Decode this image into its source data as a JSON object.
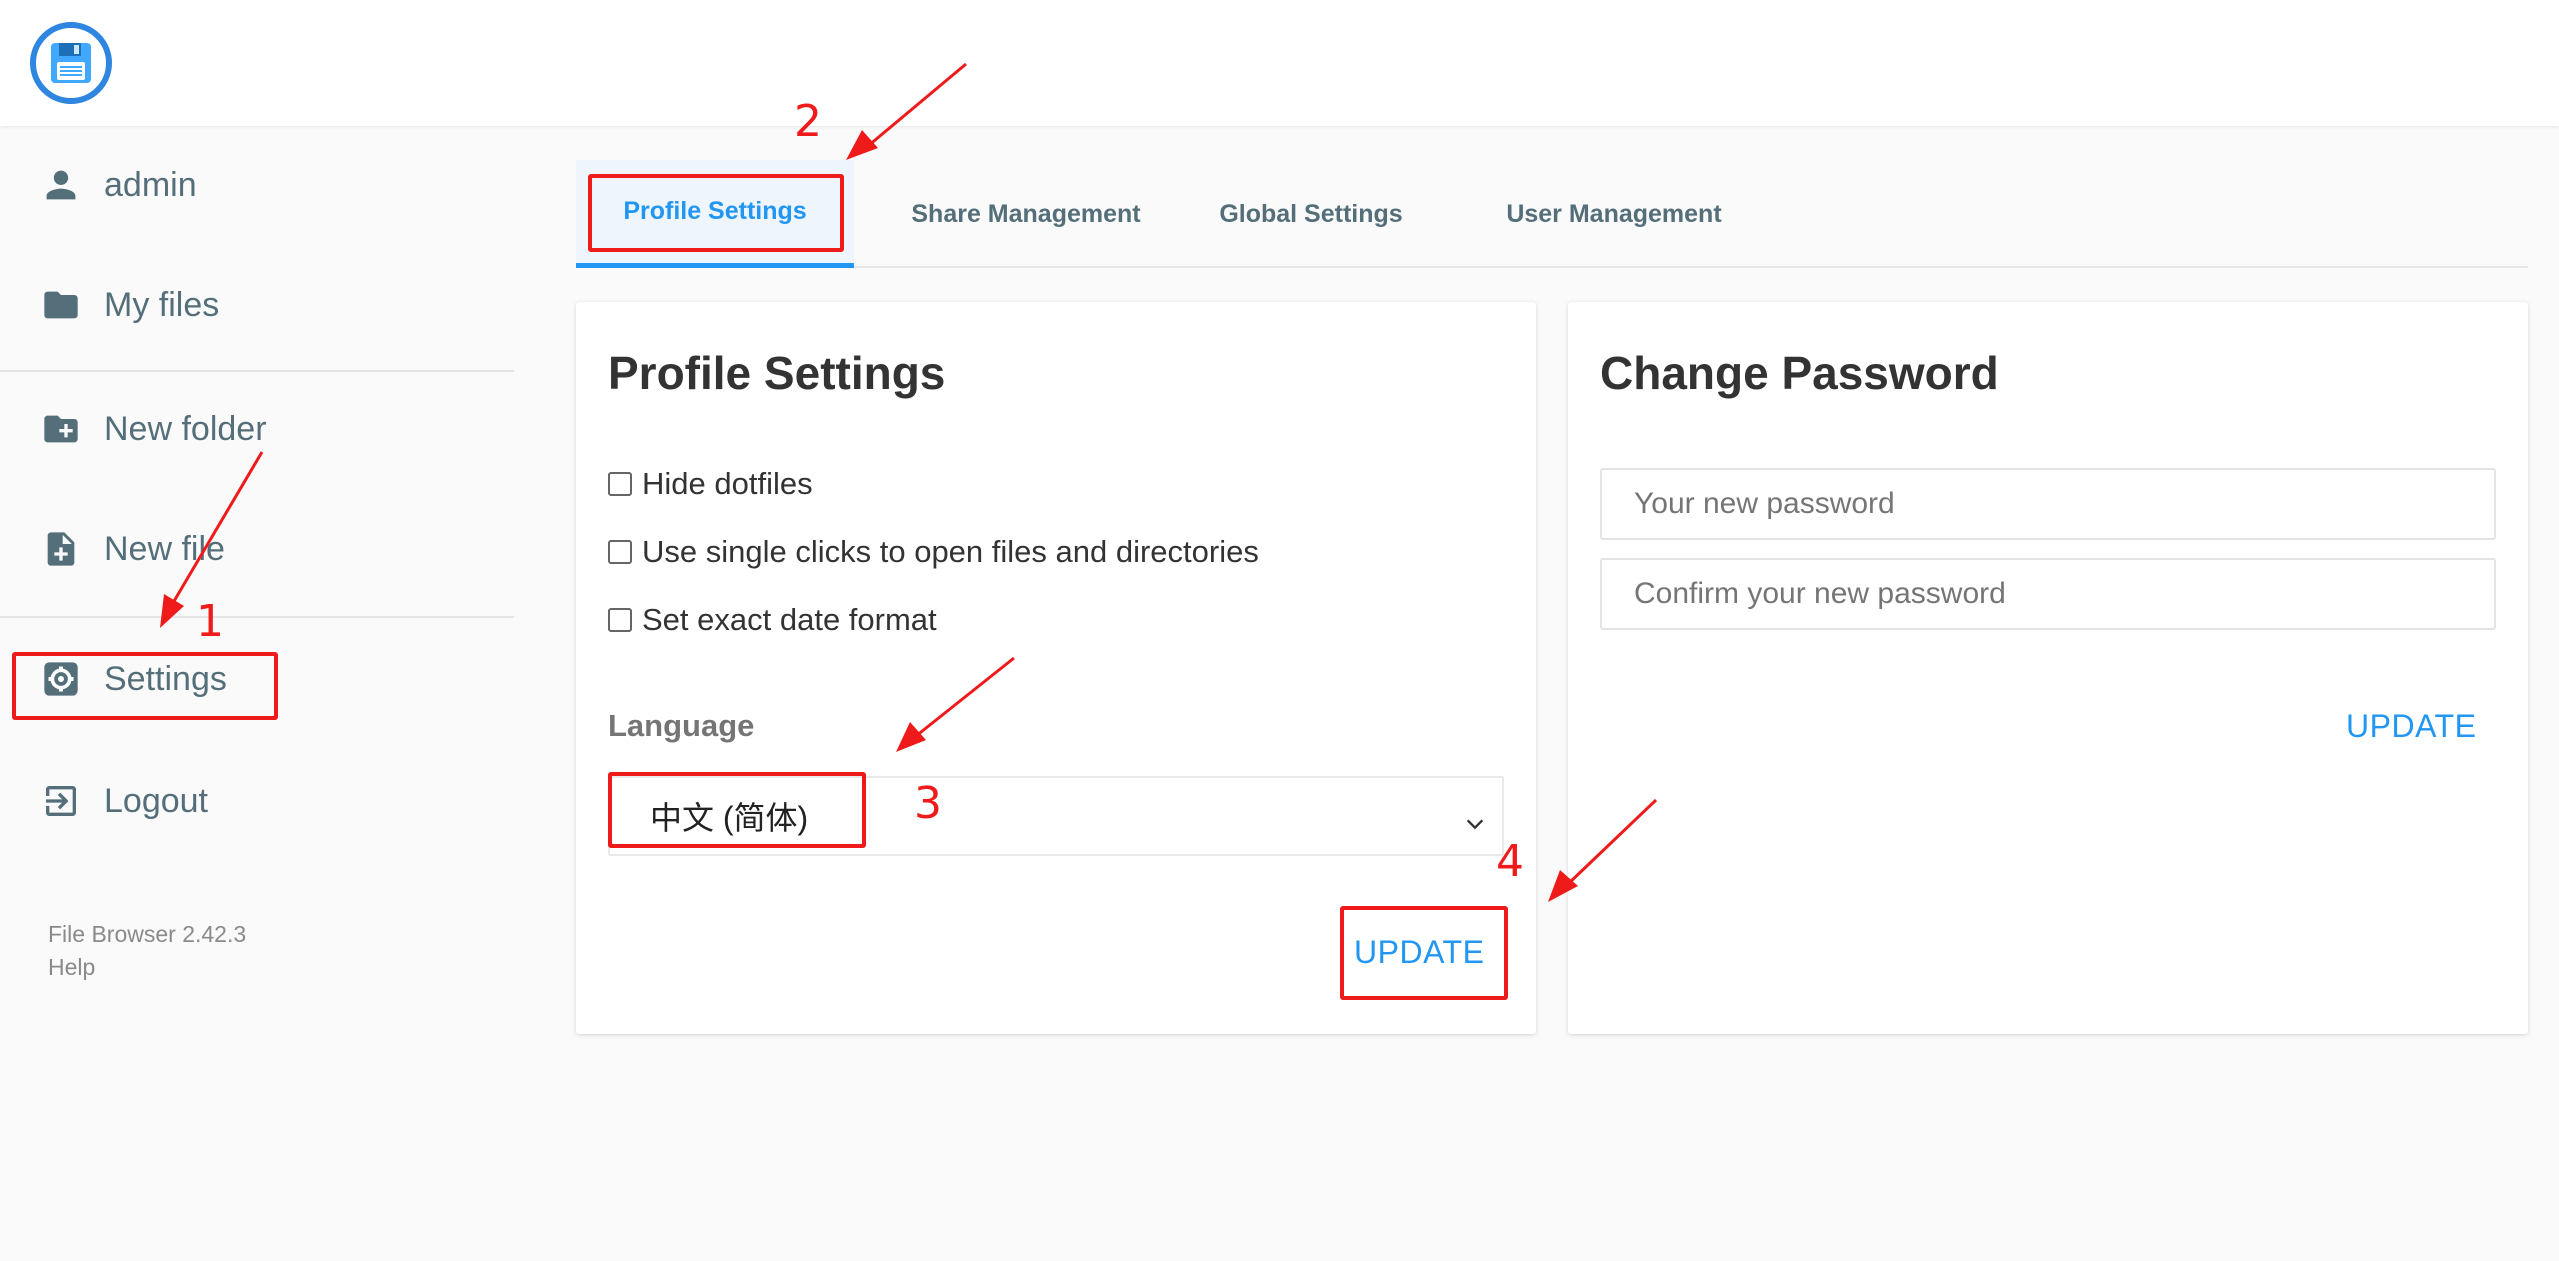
{
  "sidebar": {
    "items": [
      {
        "label": "admin",
        "icon": "person-icon"
      },
      {
        "label": "My files",
        "icon": "folder-icon"
      },
      {
        "label": "New folder",
        "icon": "new-folder-icon"
      },
      {
        "label": "New file",
        "icon": "new-file-icon"
      },
      {
        "label": "Settings",
        "icon": "gear-icon"
      },
      {
        "label": "Logout",
        "icon": "logout-icon"
      }
    ],
    "footer": {
      "version": "File Browser 2.42.3",
      "help": "Help"
    }
  },
  "tabs": [
    {
      "label": "Profile Settings",
      "active": true
    },
    {
      "label": "Share Management",
      "active": false
    },
    {
      "label": "Global Settings",
      "active": false
    },
    {
      "label": "User Management",
      "active": false
    }
  ],
  "profile": {
    "title": "Profile Settings",
    "checkboxes": [
      {
        "label": "Hide dotfiles",
        "checked": false
      },
      {
        "label": "Use single clicks to open files and directories",
        "checked": false
      },
      {
        "label": "Set exact date format",
        "checked": false
      }
    ],
    "language_label": "Language",
    "language_value": "中文 (简体)",
    "update_label": "UPDATE"
  },
  "password": {
    "title": "Change Password",
    "new_placeholder": "Your new password",
    "confirm_placeholder": "Confirm your new password",
    "update_label": "UPDATE"
  },
  "annotations": {
    "step1": "1",
    "step2": "2",
    "step3": "3",
    "step4": "4"
  },
  "colors": {
    "accent": "#2196f3",
    "sidebar_text": "#546e7a",
    "annotation": "#ef1a1a",
    "logo_ring": "#2f86e0"
  }
}
